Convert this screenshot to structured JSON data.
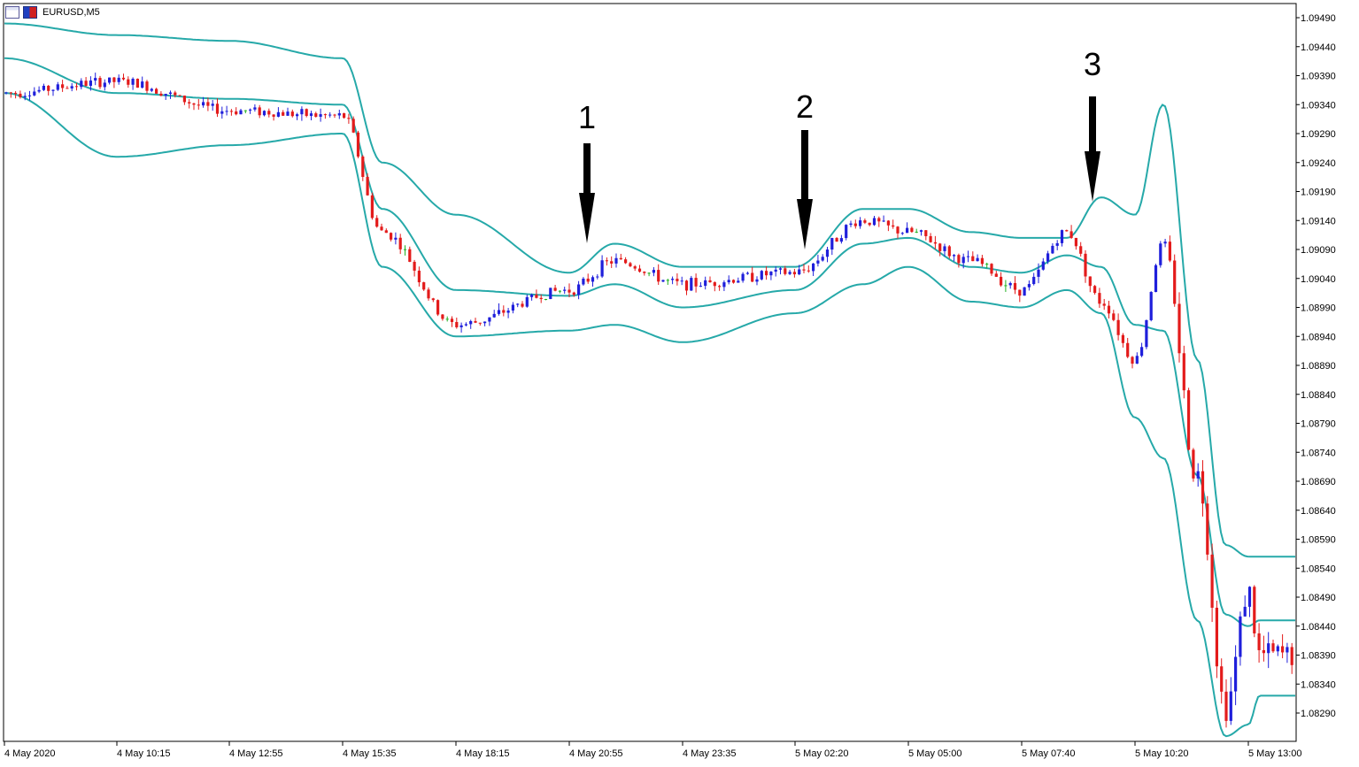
{
  "window": {
    "symbol_label": "EURUSD,M5"
  },
  "colors": {
    "background": "#ffffff",
    "frame": "#000000",
    "bull_candle": "#1f1fdb",
    "bear_candle": "#e31b1b",
    "neutral_candle": "#22b022",
    "bollinger": "#26a9a9",
    "arrow": "#000000"
  },
  "annotations": [
    {
      "label": "1",
      "x": "4 May 20:55",
      "y": 1.0914
    },
    {
      "label": "2",
      "x": "5 May 02:20",
      "y": 1.0919
    },
    {
      "label": "3",
      "x": "5 May 08:45",
      "y": 1.0929
    }
  ],
  "chart_data": {
    "type": "candlestick",
    "symbol": "EURUSD",
    "timeframe": "M5",
    "indicators": [
      "Bollinger Bands"
    ],
    "ylim": [
      1.0825,
      1.0951
    ],
    "grid": false,
    "y_ticks": [
      "1.09490",
      "1.09440",
      "1.09390",
      "1.09340",
      "1.09290",
      "1.09240",
      "1.09190",
      "1.09140",
      "1.09090",
      "1.09040",
      "1.08990",
      "1.08940",
      "1.08890",
      "1.08840",
      "1.08790",
      "1.08740",
      "1.08690",
      "1.08640",
      "1.08590",
      "1.08540",
      "1.08490",
      "1.08440",
      "1.08390",
      "1.08340",
      "1.08290"
    ],
    "x_ticks": [
      "4 May 2020",
      "4 May 10:15",
      "4 May 12:55",
      "4 May 15:35",
      "4 May 18:15",
      "4 May 20:55",
      "4 May 23:35",
      "5 May 02:20",
      "5 May 05:00",
      "5 May 07:40",
      "5 May 10:20",
      "5 May 13:00"
    ],
    "price_series": {
      "name": "EURUSD close (approx.)",
      "x": [
        "4 May 2020",
        "4 May 10:15",
        "4 May 12:55",
        "4 May 15:35",
        "4 May 16:30",
        "4 May 18:15",
        "4 May 20:55",
        "4 May 22:00",
        "4 May 23:35",
        "5 May 02:20",
        "5 May 04:00",
        "5 May 05:00",
        "5 May 06:30",
        "5 May 07:40",
        "5 May 08:45",
        "5 May 09:30",
        "5 May 10:20",
        "5 May 11:00",
        "5 May 11:45",
        "5 May 12:30",
        "5 May 13:00",
        "5 May 13:10"
      ],
      "values": [
        1.0936,
        1.0938,
        1.0933,
        1.0932,
        1.0912,
        1.0896,
        1.0902,
        1.0907,
        1.0903,
        1.0905,
        1.0914,
        1.0912,
        1.0907,
        1.0902,
        1.0912,
        1.09,
        1.089,
        1.091,
        1.087,
        1.083,
        1.085,
        1.0839
      ]
    },
    "bands": {
      "upper": [
        1.0948,
        1.0946,
        1.0945,
        1.0942,
        1.0924,
        1.0915,
        1.0905,
        1.091,
        1.0906,
        1.0906,
        1.0916,
        1.0916,
        1.0912,
        1.0911,
        1.0911,
        1.0918,
        1.0915,
        1.0934,
        1.089,
        1.0858,
        1.0856,
        1.0856
      ],
      "middle": [
        1.0942,
        1.0936,
        1.0935,
        1.0934,
        1.0916,
        1.0902,
        1.0901,
        1.0903,
        1.0899,
        1.0902,
        1.091,
        1.0911,
        1.0906,
        1.0905,
        1.0908,
        1.0906,
        1.0896,
        1.0895,
        1.087,
        1.0846,
        1.0844,
        1.0845
      ],
      "lower": [
        1.0936,
        1.0925,
        1.0927,
        1.0929,
        1.0906,
        1.0894,
        1.0895,
        1.0896,
        1.0893,
        1.0898,
        1.0903,
        1.0906,
        1.09,
        1.0899,
        1.0902,
        1.0898,
        1.088,
        1.0873,
        1.0845,
        1.0825,
        1.0827,
        1.0832
      ]
    }
  }
}
